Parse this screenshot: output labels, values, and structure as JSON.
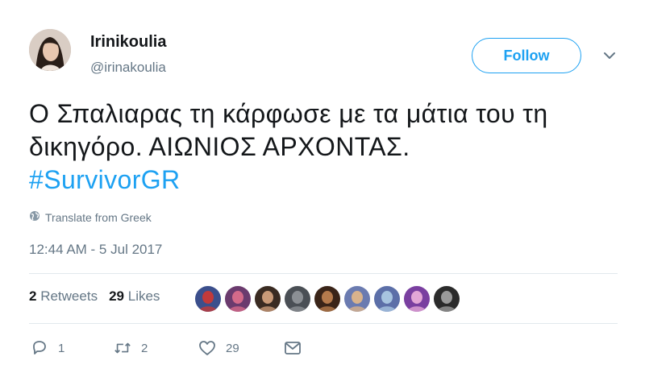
{
  "user": {
    "display_name": "Irinikoulia",
    "handle": "@irinakoulia",
    "avatar_icon": "profile-photo"
  },
  "header": {
    "follow_label": "Follow",
    "caret_icon": "chevron-down-icon"
  },
  "tweet": {
    "line1": "Ο Σπαλιαρας τη κάρφωσε με τα μάτια του τη",
    "line2": "δικηγόρο. ΑΙΩΝΙΟΣ ΑΡΧΟΝΤΑΣ.",
    "hashtag": "#SurvivorGR",
    "translate_label": "Translate from Greek",
    "timestamp": "12:44 AM - 5 Jul 2017"
  },
  "stats": {
    "retweets_count": "2",
    "retweets_label": "Retweets",
    "likes_count": "29",
    "likes_label": "Likes"
  },
  "likers": [
    {
      "name": "liker-1",
      "colors": [
        "#3b4f8c",
        "#c23a3a"
      ]
    },
    {
      "name": "liker-2",
      "colors": [
        "#6b3b6e",
        "#d46a8a"
      ]
    },
    {
      "name": "liker-3",
      "colors": [
        "#3a2b22",
        "#c99a78"
      ]
    },
    {
      "name": "liker-4",
      "colors": [
        "#4a4f55",
        "#8b8f94"
      ]
    },
    {
      "name": "liker-5",
      "colors": [
        "#3a2418",
        "#b57a4c"
      ]
    },
    {
      "name": "liker-6",
      "colors": [
        "#6b7bb0",
        "#d9b38c"
      ]
    },
    {
      "name": "liker-7",
      "colors": [
        "#5c6fa8",
        "#a7c4e0"
      ]
    },
    {
      "name": "liker-8",
      "colors": [
        "#7a3fa0",
        "#e3a6d6"
      ]
    },
    {
      "name": "liker-9",
      "colors": [
        "#2b2b2b",
        "#9a9a9a"
      ]
    }
  ],
  "actions": {
    "reply_count": "1",
    "retweet_count": "2",
    "like_count": "29"
  },
  "colors": {
    "accent": "#1da1f2",
    "text": "#14171a",
    "muted": "#657786",
    "divider": "#e1e8ed"
  }
}
